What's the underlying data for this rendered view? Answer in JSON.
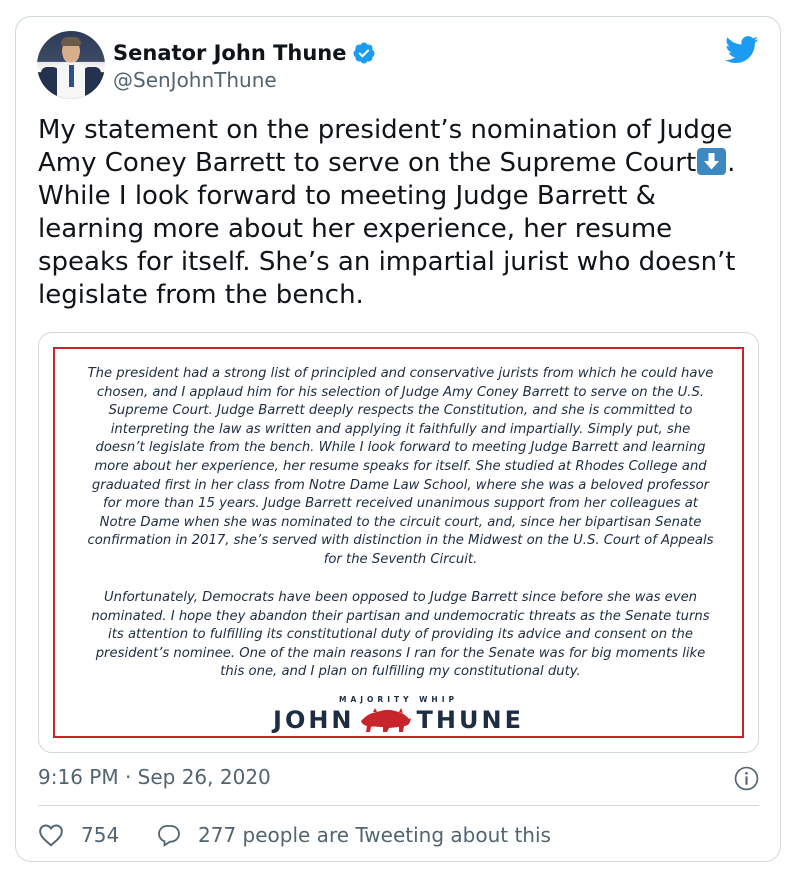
{
  "author": {
    "name": "Senator John Thune",
    "handle": "@SenJohnThune",
    "verified": true
  },
  "tweet": {
    "text_before_emoji": "My statement on the president’s nomination of Judge\nAmy Coney Barrett to serve on the Supreme Court",
    "emoji": "down-arrow-emoji",
    "text_after_emoji": ".\nWhile I look forward to meeting Judge Barrett &\nlearning more about her experience, her resume\nspeaks for itself. She’s an impartial jurist who doesn’t\nlegislate from the bench."
  },
  "statement_image": {
    "paragraph_1": "The president had a strong list of principled and conservative jurists from which he could have chosen, and I applaud him for his selection of Judge Amy Coney Barrett to serve on the U.S. Supreme Court. Judge Barrett deeply respects the Constitution, and she is committed to interpreting the law as written and applying it faithfully and impartially. Simply put, she doesn’t legislate from the bench. While I look forward to meeting Judge Barrett and learning more about her experience, her resume speaks for itself. She studied at Rhodes College and graduated first in her class from Notre Dame Law School, where she was a beloved professor for more than 15 years. Judge Barrett received unanimous support from her colleagues at Notre Dame when she was nominated to the circuit court, and, since her bipartisan Senate confirmation in 2017, she’s served with distinction in the Midwest on the U.S. Court of Appeals for the Seventh Circuit.",
    "paragraph_2": "Unfortunately, Democrats have been opposed to Judge Barrett since before she was even nominated. I hope they abandon their partisan and undemocratic threats as the Senate turns its attention to fulfilling its constitutional duty of providing its advice and consent on the president’s nominee. One of the main reasons I ran for the Senate was for big moments like this one, and I plan on fulfilling my constitutional duty.",
    "wordmark_sub": "MAJORITY WHIP",
    "wordmark_left": "JOHN",
    "wordmark_right": "THUNE",
    "border_color": "#c8242b"
  },
  "meta": {
    "timestamp": "9:16 PM · Sep 26, 2020"
  },
  "engagement": {
    "likes": "754",
    "conversation": "277 people are Tweeting about this"
  },
  "colors": {
    "twitter_blue": "#1d9bf0",
    "secondary_text": "#536471",
    "border": "#cfd9de"
  }
}
